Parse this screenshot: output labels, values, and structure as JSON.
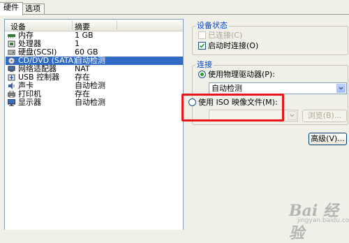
{
  "tabs": [
    {
      "label": "硬件",
      "active": true
    },
    {
      "label": "选项",
      "active": false
    }
  ],
  "device_list": {
    "columns": [
      "设备",
      "摘要"
    ],
    "rows": [
      {
        "name": "内存",
        "summary": "1 GB",
        "icon": "memory-icon",
        "selected": false
      },
      {
        "name": "处理器",
        "summary": "1",
        "icon": "processor-icon",
        "selected": false
      },
      {
        "name": "硬盘(SCSI)",
        "summary": "60 GB",
        "icon": "harddisk-icon",
        "selected": false
      },
      {
        "name": "CD/DVD (SATA)",
        "summary": "自动检测",
        "icon": "cd-dvd-icon",
        "selected": true
      },
      {
        "name": "网络适配器",
        "summary": "NAT",
        "icon": "network-adapter-icon",
        "selected": false
      },
      {
        "name": "USB 控制器",
        "summary": "存在",
        "icon": "usb-icon",
        "selected": false
      },
      {
        "name": "声卡",
        "summary": "自动检测",
        "icon": "sound-icon",
        "selected": false
      },
      {
        "name": "打印机",
        "summary": "存在",
        "icon": "printer-icon",
        "selected": false
      },
      {
        "name": "显示器",
        "summary": "自动检测",
        "icon": "display-icon",
        "selected": false
      }
    ]
  },
  "device_status": {
    "title": "设备状态",
    "connected": {
      "label": "已连接(C)",
      "checked": false,
      "enabled": false
    },
    "connect_on_power_on": {
      "label": "启动时连接(O)",
      "checked": true,
      "enabled": true
    }
  },
  "connection": {
    "title": "连接",
    "use_physical_drive": {
      "label": "使用物理驱动器(P):",
      "selected": true
    },
    "physical_drive_value": "自动检测",
    "use_iso": {
      "label": "使用 ISO 映像文件(M):",
      "selected": false
    },
    "iso_value": "",
    "browse_label": "浏览(B)...",
    "advanced_label": "高级(V)..."
  },
  "watermark": {
    "big": "Bai 经验",
    "small": "jingyan.baidu.com"
  },
  "colors": {
    "selection": "#316ac5",
    "highlight_box": "#e8151b",
    "group_title": "#0046d5"
  }
}
